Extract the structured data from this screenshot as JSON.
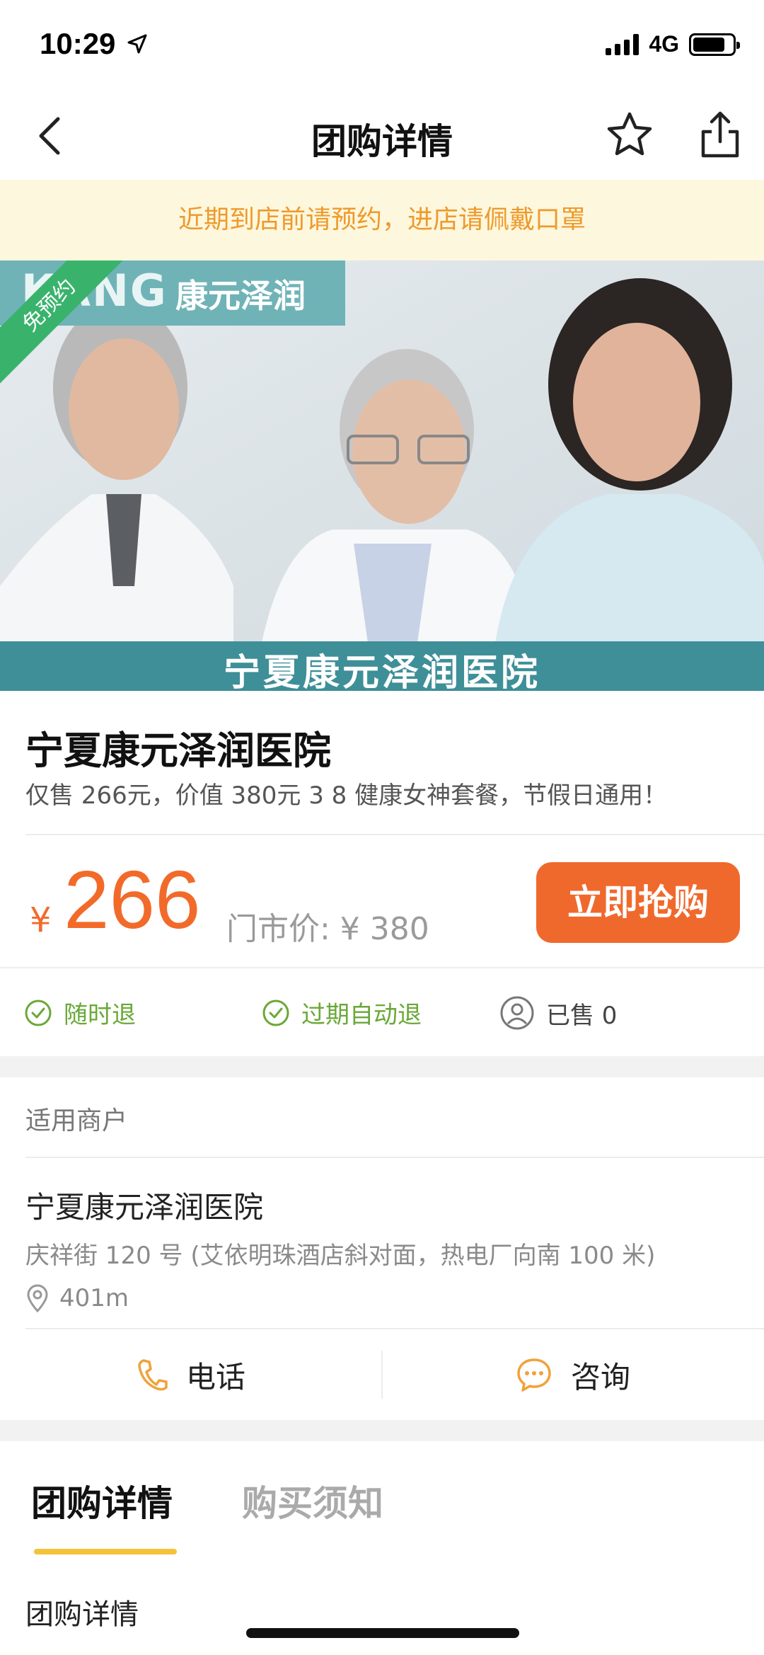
{
  "status_bar": {
    "time": "10:29",
    "network": "4G"
  },
  "nav": {
    "title": "团购详情"
  },
  "notice": "近期到店前请预约，进店请佩戴口罩",
  "banner": {
    "badge": "免预约",
    "logo_text": "康元泽润",
    "logo_en": "KANG",
    "caption": "宁夏康元泽润医院"
  },
  "deal": {
    "title": "宁夏康元泽润医院",
    "subtitle": "仅售 266元，价值 380元 3 8 健康女神套餐，节假日通用！"
  },
  "price": {
    "currency": "¥",
    "value": "266",
    "market_price": "门市价: ¥ 380",
    "buy_label": "立即抢购"
  },
  "features": [
    {
      "label": "随时退",
      "icon": "check-circle-icon"
    },
    {
      "label": "过期自动退",
      "icon": "check-circle-icon"
    },
    {
      "label": "已售 0",
      "icon": "user-circle-icon"
    }
  ],
  "merchant": {
    "section_label": "适用商户",
    "name": "宁夏康元泽润医院",
    "address": "庆祥街 120 号 (艾依明珠酒店斜对面，热电厂向南 100 米)",
    "distance": "401m",
    "phone_label": "电话",
    "consult_label": "咨询"
  },
  "tabs": [
    {
      "label": "团购详情",
      "active": true
    },
    {
      "label": "购买须知",
      "active": false
    }
  ],
  "detail_heading": "团购详情",
  "colors": {
    "accent": "#f0692c",
    "price": "#f26a2a",
    "notice_bg": "#fdf7dd",
    "notice_text": "#ee9a2c",
    "green": "#6aa837",
    "tab_underline": "#f5c23a",
    "icon_orange": "#f0a23a"
  }
}
